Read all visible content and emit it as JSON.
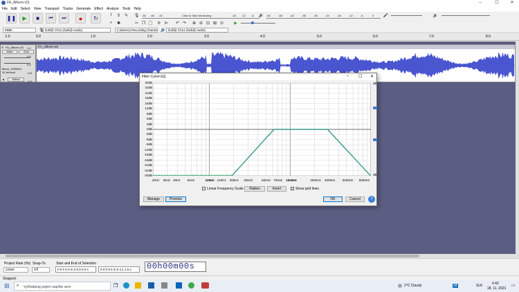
{
  "window": {
    "title": "FA_Allkom-US",
    "minimize": "–",
    "maximize": "☐",
    "close": "✕"
  },
  "menu": [
    "File",
    "Edit",
    "Select",
    "View",
    "Transport",
    "Tracks",
    "Generate",
    "Effect",
    "Analyze",
    "Tools",
    "Help"
  ],
  "toolbar": {
    "monitor_label": "Click to Start Monitoring",
    "rec_meter_ticks": [
      "-54",
      "-48",
      "-42",
      "-18",
      "-12",
      "-6",
      "0"
    ],
    "play_meter_ticks": [
      "-54",
      "-48",
      "-42",
      "-36",
      "-30",
      "-24",
      "-18",
      "-12",
      "-6",
      "0"
    ]
  },
  "devices": {
    "host": "MME",
    "input": "šuši@ Ch12 (šuši@ Audio)",
    "channels": "2 (Stereo) Recording Channe",
    "output": "šuši@ Ch12 (šuši@ Audio)"
  },
  "ruler": {
    "ticks": [
      [
        "-1.0",
        6
      ],
      [
        "0.0",
        52
      ],
      [
        "1.0",
        131
      ],
      [
        "2.0",
        213
      ],
      [
        "3.0",
        295
      ],
      [
        "4.0",
        376
      ],
      [
        "5.0",
        458
      ],
      [
        "6.0",
        539
      ],
      [
        "7.0",
        620
      ],
      [
        "8.0",
        702
      ]
    ]
  },
  "track": {
    "name": "FA_Allkom-US",
    "mute": "Mute",
    "solo": "Solo",
    "info": "Mono, 22050Hz\n32-bit float",
    "select": "Select",
    "scale": [
      "1.0",
      "0.5",
      "0.0",
      "-0.5",
      "-1.0"
    ],
    "clip_name": "FA_Allkom-US"
  },
  "dialog": {
    "title": "Filter Curve EQ",
    "db_labels": [
      "30dB",
      "24dB",
      "21dB",
      "18dB",
      "15dB",
      "12dB",
      "9dB",
      "6dB",
      "3dB",
      "0dB",
      "-3dB",
      "-6dB",
      "-9dB",
      "-12dB",
      "-15dB",
      "-18dB",
      "-21dB",
      "-24dB",
      "-30dB"
    ],
    "right_top": "dB",
    "right_bottom": "dB",
    "freq_labels": [
      "20Hz",
      "30Hz",
      "40Hz",
      "60Hz",
      "100Hz",
      "140Hz",
      "200Hz",
      "300Hz",
      "500Hz",
      "700Hz",
      "1000Hz",
      "2000Hz",
      "3000Hz",
      "5000Hz",
      "8000Hz"
    ],
    "linear_scale": "Linear Frequency Scale",
    "flatten": "Flatten",
    "invert": "Invert",
    "show_grid": "Show grid lines",
    "manage": "Manage",
    "preview": "Preview",
    "ok": "OK",
    "cancel": "Cancel",
    "curve_color": "#3a9a8a",
    "help": "?"
  },
  "selection": {
    "rate_label": "Project Rate (Hz)",
    "snap_label": "Snap-To",
    "range_label": "Start and End of Selection",
    "rate": "22050",
    "snap": "Off",
    "start": "0 0 h 0 0 m 0 0.0 0 0 s",
    "end": "0 0 h 0 0 m 0 4.1 1 5 s",
    "time": "00h00m00s"
  },
  "status": "Stopped.",
  "taskbar": {
    "search": "Vyhľadávaj pojem napíšte sem",
    "weather": "2°C  Cloudy",
    "lang": "SLK",
    "time": "0:42",
    "date": "18. 11. 2021",
    "badge": "34"
  }
}
